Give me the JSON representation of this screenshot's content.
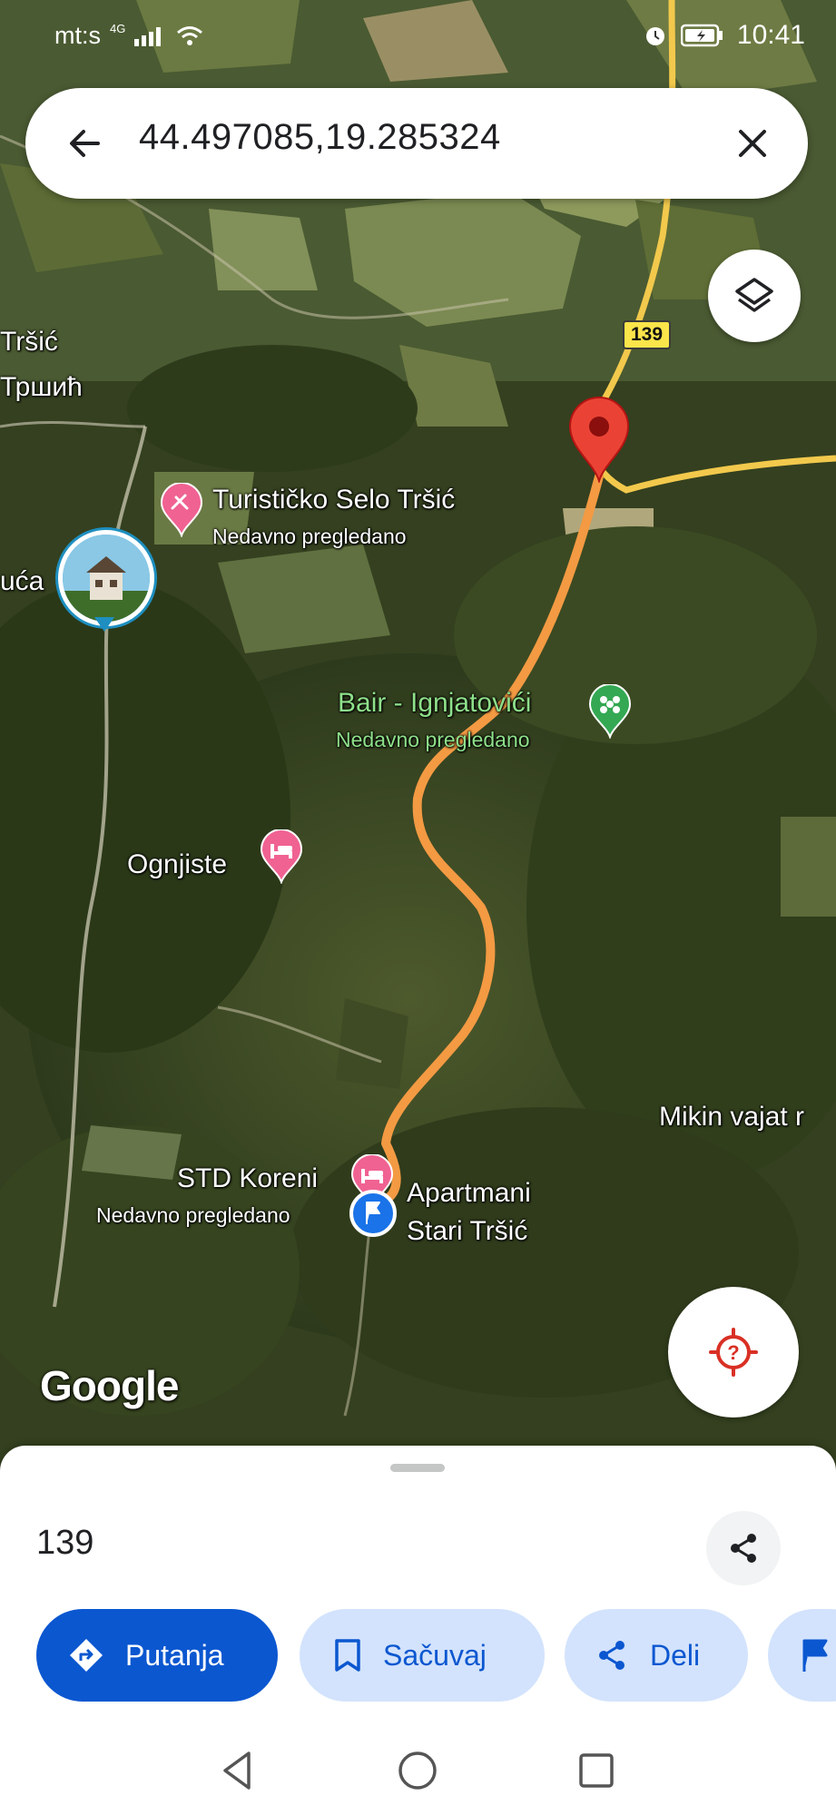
{
  "status_bar": {
    "carrier": "mt:s",
    "network": "4G",
    "time": "10:41"
  },
  "search": {
    "query": "44.497085,19.285324",
    "back_icon": "arrow-back-icon",
    "clear_icon": "close-icon"
  },
  "map": {
    "road_shield": "139",
    "places": [
      {
        "name": "Tršić",
        "name_cyrillic": "Тршић"
      },
      {
        "name": "Turističko Selo Tršić",
        "subtitle": "Nedavno pregledano"
      },
      {
        "name": "uća"
      },
      {
        "name": "Bair - Ignjatovići",
        "subtitle": "Nedavno pregledano"
      },
      {
        "name": "Ognjiste"
      },
      {
        "name": "Mikin vajat r"
      },
      {
        "name": "STD Koreni",
        "subtitle": "Nedavno pregledano"
      },
      {
        "name": "Apartmani",
        "name_line2": "Stari Tršić"
      }
    ],
    "attribution": "Google",
    "colors": {
      "route": "#f39a43",
      "pin_red": "#ea4335",
      "pin_pink": "#f06292",
      "pin_green": "#34a853",
      "road_yellow": "#f2c94c"
    }
  },
  "sheet": {
    "title": "139",
    "actions": {
      "directions": "Putanja",
      "save": "Sačuvaj",
      "share": "Deli"
    },
    "accent": "#0b57d0",
    "chip_bg": "#d3e3fd"
  }
}
